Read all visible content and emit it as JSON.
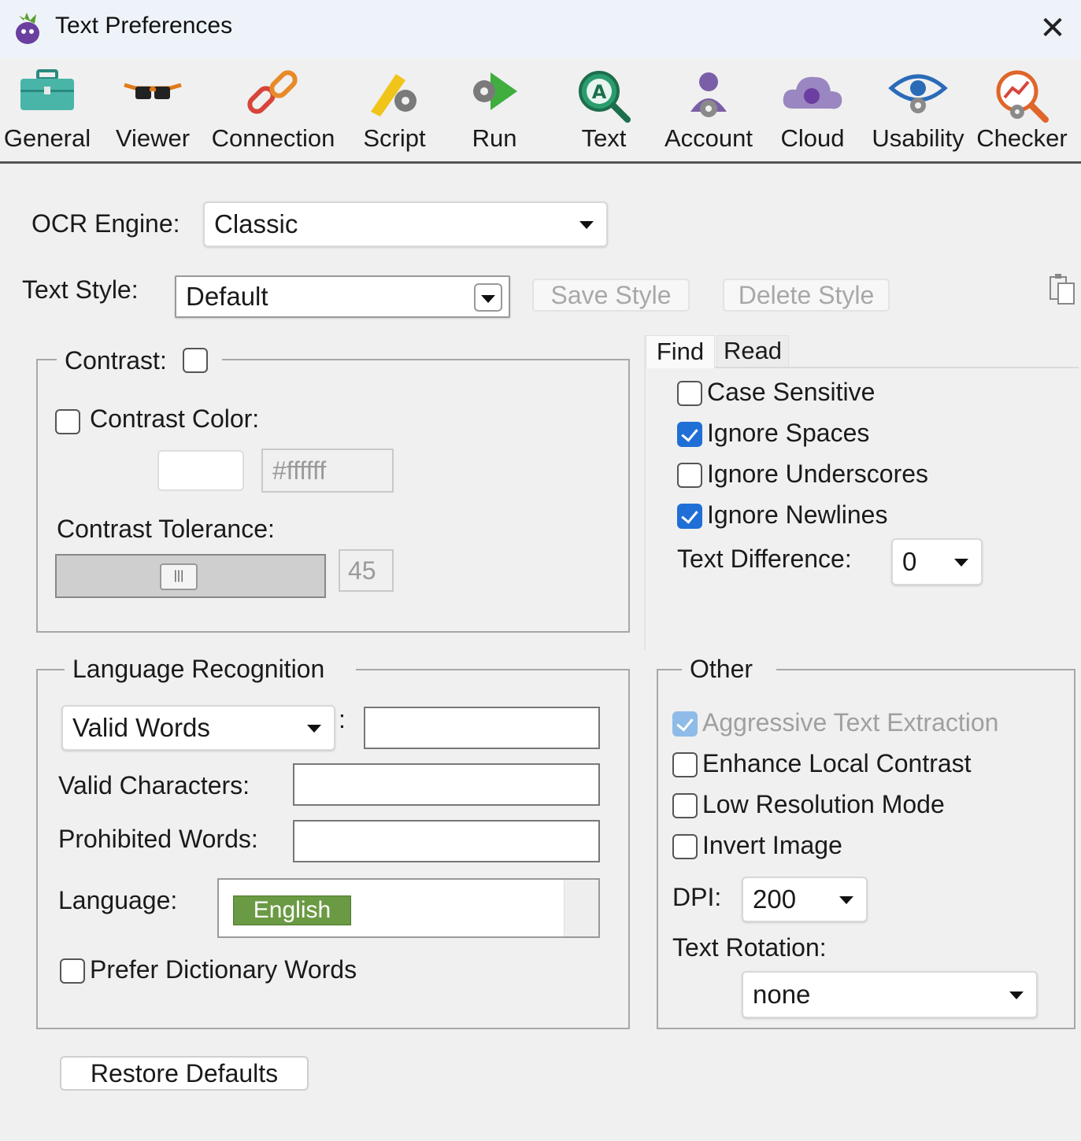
{
  "window": {
    "title": "Text Preferences"
  },
  "toolbar": {
    "items": [
      {
        "label": "General",
        "icon": "toolbox-icon"
      },
      {
        "label": "Viewer",
        "icon": "glasses-icon"
      },
      {
        "label": "Connection",
        "icon": "chain-link-icon"
      },
      {
        "label": "Script",
        "icon": "script-gear-icon"
      },
      {
        "label": "Run",
        "icon": "run-gear-icon"
      },
      {
        "label": "Text",
        "icon": "text-search-icon"
      },
      {
        "label": "Account",
        "icon": "user-gear-icon"
      },
      {
        "label": "Cloud",
        "icon": "cloud-icon"
      },
      {
        "label": "Usability",
        "icon": "eye-gear-icon"
      },
      {
        "label": "Checker",
        "icon": "chart-search-icon"
      }
    ]
  },
  "ocr": {
    "label": "OCR Engine:",
    "value": "Classic"
  },
  "style": {
    "label": "Text Style:",
    "value": "Default",
    "save": "Save Style",
    "delete": "Delete Style"
  },
  "contrast": {
    "legend": "Contrast:",
    "color_label": "Contrast Color:",
    "color_hex": "#ffffff",
    "tolerance_label": "Contrast Tolerance:",
    "tolerance_value": "45",
    "tolerance_fraction": 0.45
  },
  "tabs": {
    "find": "Find",
    "read": "Read"
  },
  "find": {
    "options": [
      {
        "label": "Case Sensitive",
        "checked": false
      },
      {
        "label": "Ignore Spaces",
        "checked": true
      },
      {
        "label": "Ignore Underscores",
        "checked": false
      },
      {
        "label": "Ignore Newlines",
        "checked": true
      }
    ],
    "diff_label": "Text Difference:",
    "diff_value": "0"
  },
  "language": {
    "legend": "Language Recognition",
    "mode": "Valid Words",
    "colon": ":",
    "valid_chars_label": "Valid Characters:",
    "prohibited_label": "Prohibited Words:",
    "language_label": "Language:",
    "language_value": "English",
    "prefer_label": "Prefer Dictionary Words"
  },
  "other": {
    "legend": "Other",
    "aggressive": "Aggressive Text Extraction",
    "enhance": "Enhance Local Contrast",
    "lowres": "Low Resolution Mode",
    "invert": "Invert Image",
    "dpi_label": "DPI:",
    "dpi_value": "200",
    "rotation_label": "Text Rotation:",
    "rotation_value": "none"
  },
  "footer": {
    "restore": "Restore Defaults"
  },
  "colors": {
    "accent": "#1f6fd6",
    "language_chip": "#6a9a43"
  }
}
